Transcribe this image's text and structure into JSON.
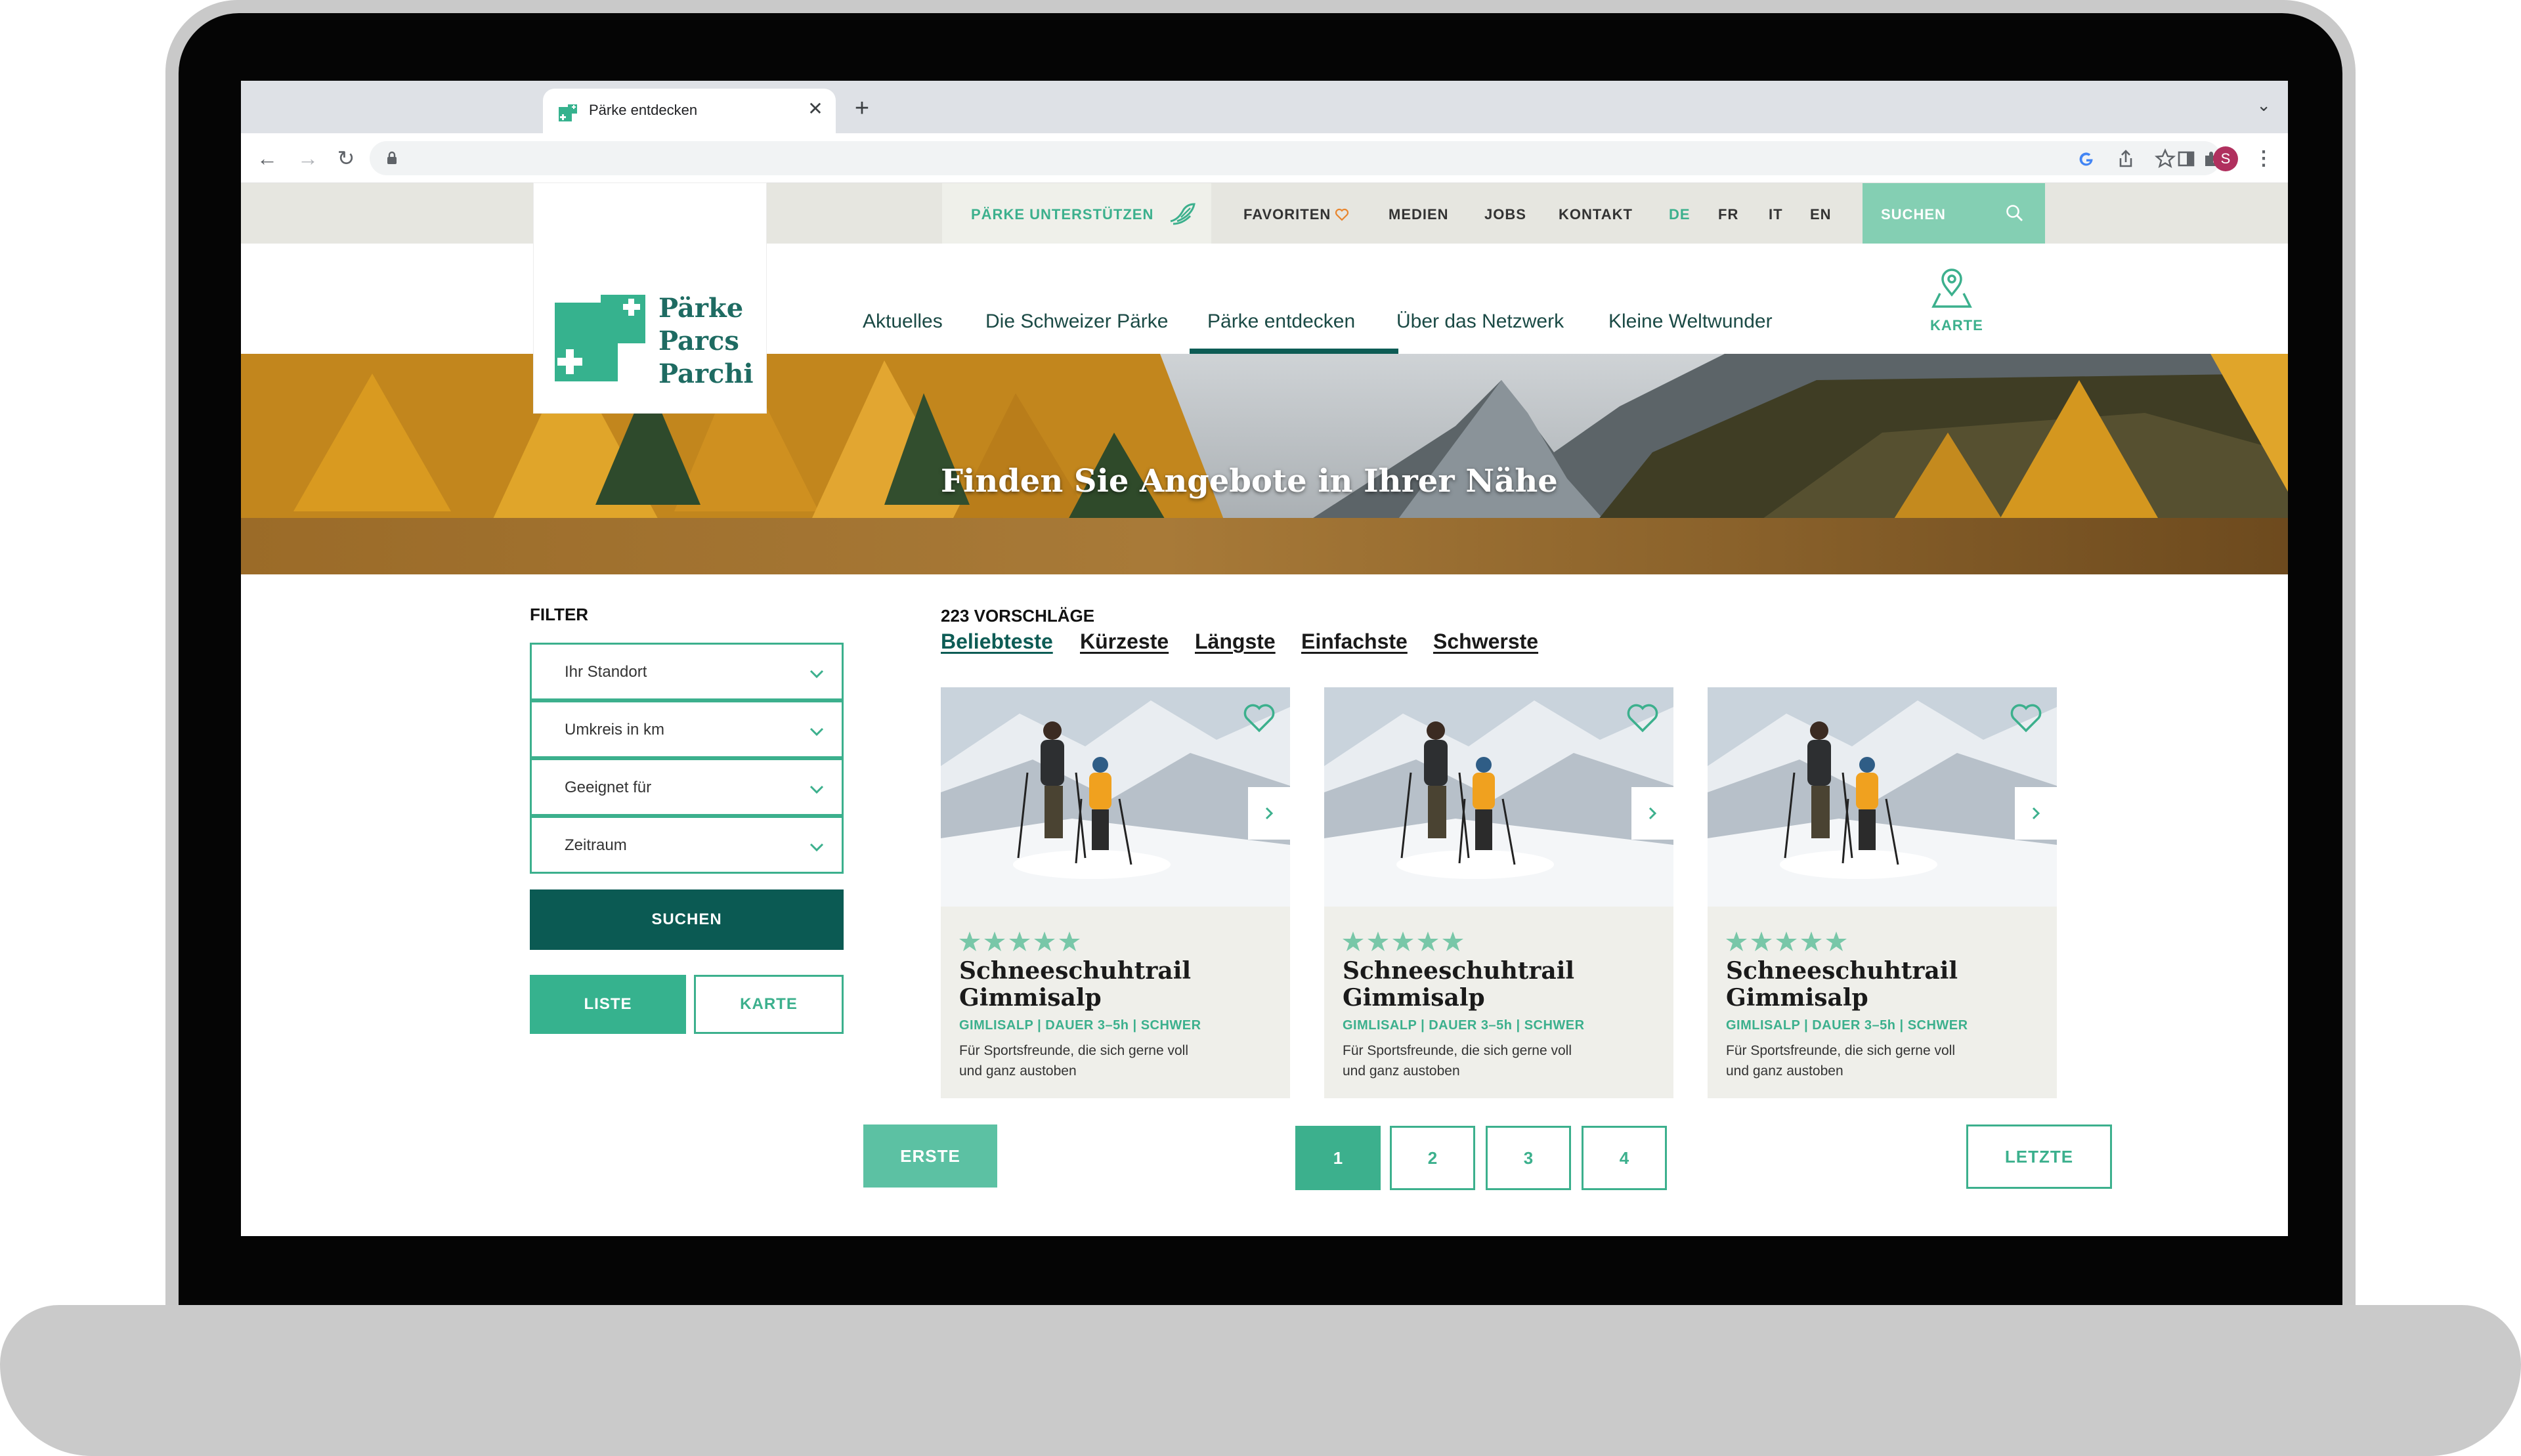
{
  "browser": {
    "tab_title": "Pärke entdecken",
    "tab_close": "✕",
    "new_tab": "+",
    "profile_initial": "S"
  },
  "utility_nav": {
    "support": "PÄRKE UNTERSTÜTZEN",
    "favoriten": "FAVORITEN",
    "medien": "MEDIEN",
    "jobs": "JOBS",
    "kontakt": "KONTAKT",
    "languages": [
      "DE",
      "FR",
      "IT",
      "EN"
    ],
    "search": "SUCHEN"
  },
  "logo": {
    "lines": [
      "Pärke",
      "Parcs",
      "Parchi"
    ]
  },
  "main_nav": {
    "items": [
      "Aktuelles",
      "Die Schweizer Pärke",
      "Pärke entdecken",
      "Über das Netzwerk",
      "Kleine Weltwunder"
    ],
    "active": "Pärke entdecken",
    "karte": "KARTE"
  },
  "hero": {
    "title": "Finden Sie Angebote in Ihrer Nähe"
  },
  "filter": {
    "label": "FILTER",
    "selects": [
      "Ihr Standort",
      "Umkreis in km",
      "Geeignet für",
      "Zeitraum"
    ],
    "search_button": "SUCHEN",
    "view_list": "LISTE",
    "view_map": "KARTE"
  },
  "results": {
    "count": "223 VORSCHLÄGE",
    "sort_options": [
      "Beliebteste",
      "Kürzeste",
      "Längste",
      "Einfachste",
      "Schwerste"
    ],
    "cards": [
      {
        "title": "Schneeschuhtrail Gimmisalp",
        "meta": "GIMLISALP | DAUER 3–5h | SCHWER",
        "description": "Für Sportsfreunde, die sich gerne voll und ganz austoben",
        "rating": 5
      },
      {
        "title": "Schneeschuhtrail Gimmisalp",
        "meta": "GIMLISALP | DAUER 3–5h | SCHWER",
        "description": "Für Sportsfreunde, die sich gerne voll und ganz austoben",
        "rating": 5
      },
      {
        "title": "Schneeschuhtrail Gimmisalp",
        "meta": "GIMLISALP | DAUER 3–5h | SCHWER",
        "description": "Für Sportsfreunde, die sich gerne voll und ganz austoben",
        "rating": 5
      }
    ]
  },
  "pagination": {
    "first": "ERSTE",
    "pages": [
      "1",
      "2",
      "3",
      "4"
    ],
    "active_page": "1",
    "last": "LETZTE"
  },
  "colors": {
    "brand_green": "#3cb08d",
    "dark_green": "#0b5a53",
    "mint": "#84cfb3",
    "card_bg": "#efefea"
  }
}
